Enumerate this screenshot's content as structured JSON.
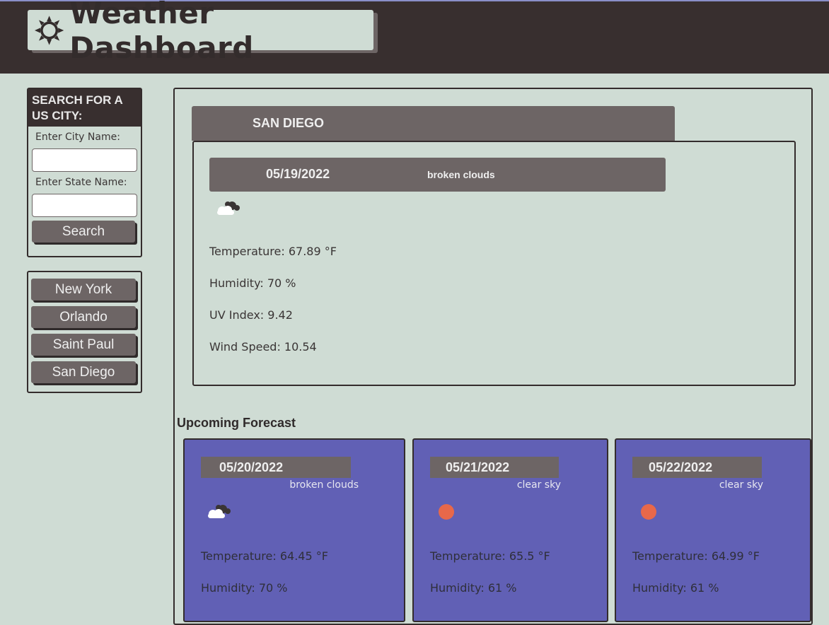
{
  "header": {
    "title": "Weather Dashboard",
    "icon": "sun-icon"
  },
  "search": {
    "heading": "SEARCH FOR A US CITY:",
    "city_label": "Enter City Name:",
    "city_value": "",
    "state_label": "Enter State Name:",
    "state_value": "",
    "button_label": "Search"
  },
  "history": {
    "items": [
      "New York",
      "Orlando",
      "Saint Paul",
      "San Diego"
    ]
  },
  "current": {
    "city": "SAN DIEGO",
    "date": "05/19/2022",
    "description": "broken clouds",
    "icon": "broken-clouds-icon",
    "temperature": "Temperature: 67.89 °F",
    "humidity": "Humidity: 70 %",
    "uv_index": "UV Index: 9.42",
    "wind_speed": "Wind Speed: 10.54"
  },
  "forecast": {
    "heading": "Upcoming Forecast",
    "days": [
      {
        "date": "05/20/2022",
        "description": "broken clouds",
        "icon": "broken-clouds-icon",
        "temperature": "Temperature: 64.45 °F",
        "humidity": "Humidity: 70 %"
      },
      {
        "date": "05/21/2022",
        "description": "clear sky",
        "icon": "clear-sky-icon",
        "temperature": "Temperature: 65.5 °F",
        "humidity": "Humidity: 61 %"
      },
      {
        "date": "05/22/2022",
        "description": "clear sky",
        "icon": "clear-sky-icon",
        "temperature": "Temperature: 64.99 °F",
        "humidity": "Humidity: 61 %"
      }
    ]
  },
  "colors": {
    "header_bg": "#382f2f",
    "page_bg": "#cfdcd4",
    "button_bg": "#6d6565",
    "card_bg": "#6160b5",
    "sun_color": "#e8684a"
  }
}
